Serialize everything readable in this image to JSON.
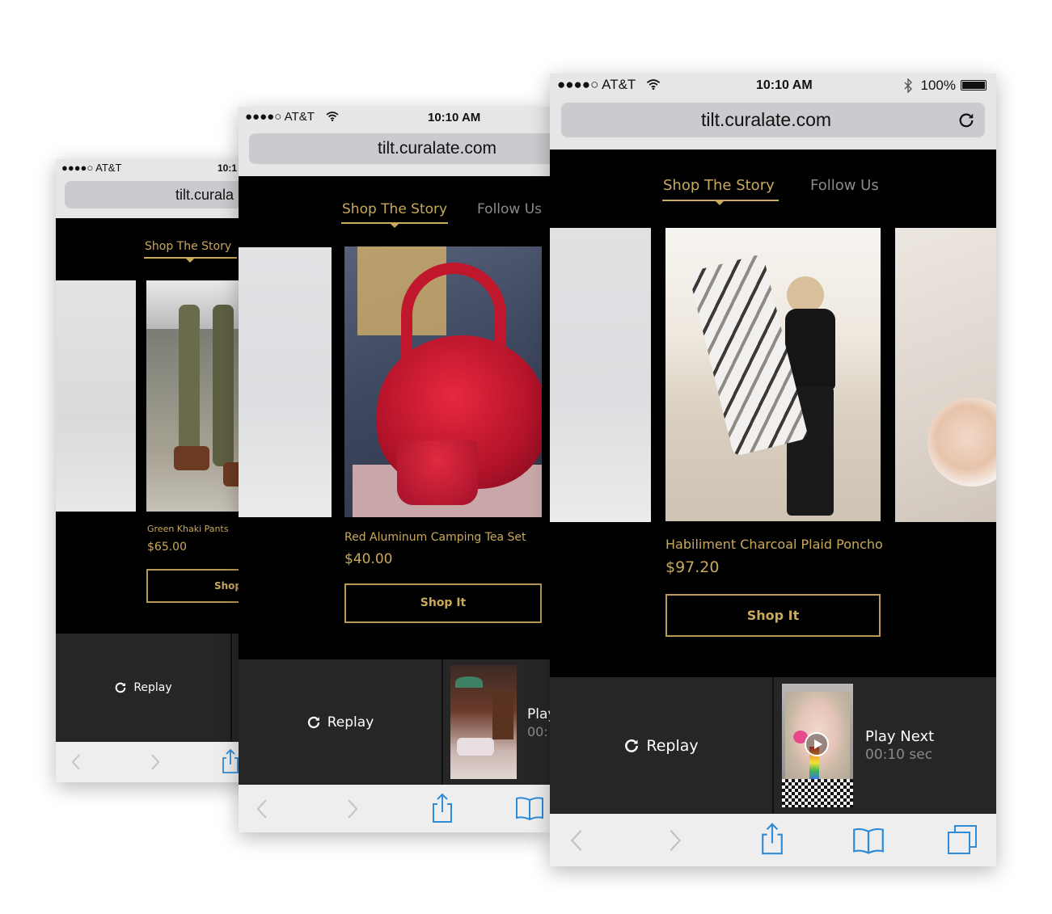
{
  "colors": {
    "accent": "#c9a95c",
    "ios_blue": "#2f8bd6",
    "bar_bg": "#262626"
  },
  "browser": {
    "carrier": "●●●●○ AT&T",
    "time": "10:10 AM",
    "battery": "100%",
    "url": "tilt.curalate.com"
  },
  "phones": [
    {
      "time_partial": "10:1",
      "url_partial": "tilt.curala",
      "tabs": {
        "active": "Shop The Story"
      },
      "product": {
        "name": "Green Khaki Pants",
        "price": "$65.00",
        "button": "Shop"
      },
      "bottom": {
        "replay": "Replay"
      }
    },
    {
      "tabs": {
        "active": "Shop The Story",
        "inactive": "Follow Us"
      },
      "product": {
        "name": "Red Aluminum Camping Tea Set",
        "price": "$40.00",
        "button": "Shop It"
      },
      "bottom": {
        "replay": "Replay",
        "play_next_partial": "Play",
        "countdown_partial": "00:"
      }
    },
    {
      "tabs": {
        "active": "Shop The Story",
        "inactive": "Follow Us"
      },
      "product": {
        "name": "Habiliment Charcoal Plaid Poncho",
        "price": "$97.20",
        "button": "Shop It"
      },
      "bottom": {
        "replay": "Replay",
        "play_next": "Play Next",
        "countdown": "00:10 sec"
      }
    }
  ]
}
